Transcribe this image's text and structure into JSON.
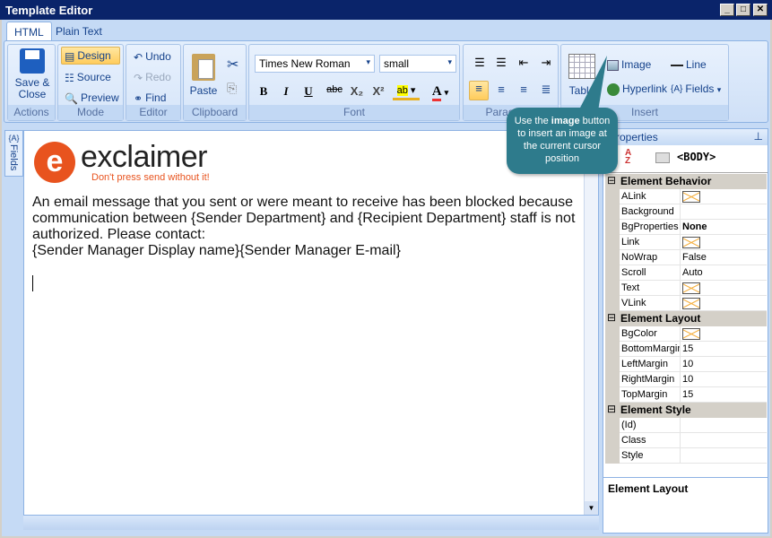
{
  "window": {
    "title": "Template Editor",
    "minimize": "_",
    "maximize": "□",
    "close": "✕"
  },
  "tabs": [
    {
      "label": "HTML",
      "active": true
    },
    {
      "label": "Plain Text",
      "active": false
    }
  ],
  "ribbon": {
    "actions": {
      "label": "Actions",
      "save_close": "Save & Close"
    },
    "mode": {
      "label": "Mode",
      "design": "Design",
      "source": "Source",
      "preview": "Preview"
    },
    "editor": {
      "label": "Editor",
      "undo": "Undo",
      "redo": "Redo",
      "find": "Find"
    },
    "clipboard": {
      "label": "Clipboard",
      "paste": "Paste"
    },
    "font": {
      "label": "Font",
      "family": "Times New Roman",
      "size": "small",
      "bold": "B",
      "italic": "I",
      "underline": "U",
      "strike": "abc",
      "subscript": "X₂",
      "superscript": "X²",
      "highlight": "ab",
      "font_color": "A"
    },
    "paragraph": {
      "label": "Paragraph"
    },
    "insert": {
      "label": "Insert",
      "table": "Table",
      "image": "Image",
      "line": "Line",
      "hyperlink": "Hyperlink",
      "fields": "Fields"
    }
  },
  "side_tab": {
    "label": "Fields",
    "icon": "{A}"
  },
  "document": {
    "logo_text": "exclaimer",
    "logo_tagline": "Don't press send without it!",
    "paragraphs": [
      "An email message that you sent or were meant to receive has been blocked because communication between {Sender Department} and {Recipient Department} staff is not authorized. Please contact:",
      "{Sender Manager Display name}{Sender Manager E-mail}"
    ]
  },
  "callout": {
    "text": "Use the image button to insert an image at the current cursor position",
    "bold_word": "image"
  },
  "properties": {
    "title": "Properties",
    "selected": "<BODY>",
    "categories": [
      {
        "name": "Element Behavior",
        "rows": [
          {
            "name": "ALink",
            "swatch": true
          },
          {
            "name": "Background",
            "value": ""
          },
          {
            "name": "BgProperties",
            "value": "None",
            "bold": true
          },
          {
            "name": "Link",
            "swatch": true
          },
          {
            "name": "NoWrap",
            "value": "False"
          },
          {
            "name": "Scroll",
            "value": "Auto"
          },
          {
            "name": "Text",
            "swatch": true
          },
          {
            "name": "VLink",
            "swatch": true
          }
        ]
      },
      {
        "name": "Element Layout",
        "rows": [
          {
            "name": "BgColor",
            "swatch": true
          },
          {
            "name": "BottomMargin",
            "value": "15"
          },
          {
            "name": "LeftMargin",
            "value": "10"
          },
          {
            "name": "RightMargin",
            "value": "10"
          },
          {
            "name": "TopMargin",
            "value": "15"
          }
        ]
      },
      {
        "name": "Element Style",
        "rows": [
          {
            "name": "(Id)",
            "value": ""
          },
          {
            "name": "Class",
            "value": ""
          },
          {
            "name": "Style",
            "value": ""
          }
        ]
      }
    ],
    "description_title": "Element Layout"
  },
  "colors": {
    "titlebar": "#0a246a",
    "ribbon_text": "#15428b",
    "logo_orange": "#e8531e",
    "callout": "#2e7b8c"
  }
}
